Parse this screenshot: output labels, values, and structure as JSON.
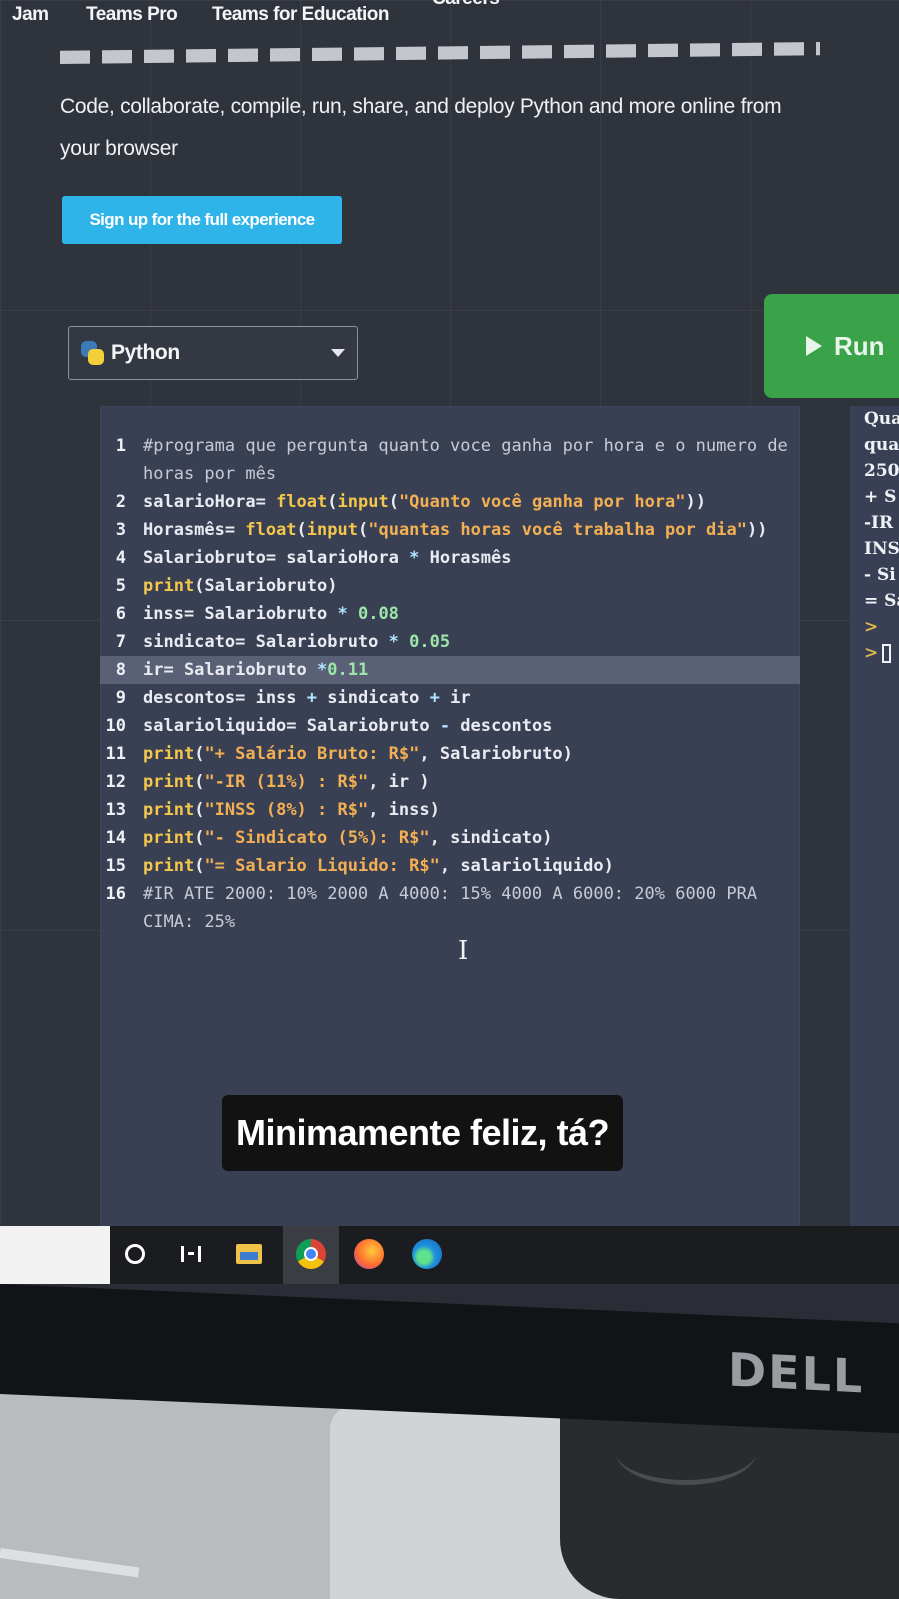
{
  "nav": {
    "items": [
      "Jam",
      "Teams Pro",
      "Teams for Education",
      "Careers"
    ]
  },
  "hero": {
    "tagline": "Code, collaborate, compile, run, share, and deploy Python and more online from your browser",
    "signup_label": "Sign up for the full experience"
  },
  "toolbar": {
    "language": "Python",
    "run_label": "Run"
  },
  "editor": {
    "lines": [
      {
        "n": "1",
        "html": "<span class=\"c\">#programa que pergunta quanto voce ganha por hora e o numero de horas por mês</span>"
      },
      {
        "n": "2",
        "html": "salarioHora= <span class=\"k\">float</span>(<span class=\"k\">input</span>(<span class=\"s\">\"Quanto você ganha por hora\"</span>))"
      },
      {
        "n": "3",
        "html": "Horasmês= <span class=\"k\">float</span>(<span class=\"k\">input</span>(<span class=\"s\">\"quantas horas você trabalha por dia\"</span>))"
      },
      {
        "n": "4",
        "html": "Salariobruto= salarioHora <span class=\"o\">*</span> Horasmês"
      },
      {
        "n": "5",
        "html": "<span class=\"k\">print</span>(Salariobruto)"
      },
      {
        "n": "6",
        "html": "inss= Salariobruto <span class=\"o\">*</span> <span class=\"n\">0.08</span>"
      },
      {
        "n": "7",
        "html": "sindicato= Salariobruto <span class=\"o\">*</span> <span class=\"n\">0.05</span>"
      },
      {
        "n": "8",
        "html": "ir= Salariobruto <span class=\"o\">*</span><span class=\"n\">0.11</span>"
      },
      {
        "n": "9",
        "html": "descontos= inss <span class=\"o\">+</span> sindicato <span class=\"o\">+</span> ir"
      },
      {
        "n": "10",
        "html": "salarioliquido= Salariobruto <span class=\"o\">-</span> descontos"
      },
      {
        "n": "11",
        "html": "<span class=\"k\">print</span>(<span class=\"s\">\"+ Salário Bruto: R$\"</span>, Salariobruto)"
      },
      {
        "n": "12",
        "html": "<span class=\"k\">print</span>(<span class=\"s\">\"-IR (11%) : R$\"</span>, ir )"
      },
      {
        "n": "13",
        "html": "<span class=\"k\">print</span>(<span class=\"s\">\"INSS (8%) : R$\"</span>, inss)"
      },
      {
        "n": "14",
        "html": "<span class=\"k\">print</span>(<span class=\"s\">\"- Sindicato (5%): R$\"</span>, sindicato)"
      },
      {
        "n": "15",
        "html": "<span class=\"k\">print</span>(<span class=\"s\">\"= Salario Liquido: R$\"</span>, salarioliquido)"
      },
      {
        "n": "16",
        "html": "<span class=\"c\">#IR ATE 2000: 10% 2000 A 4000: 15% 4000 A 6000: 20% 6000 PRA CIMA: 25%</span>"
      }
    ],
    "highlighted_line": "8"
  },
  "output": {
    "lines": [
      "Qua",
      "qua",
      "250",
      "+ S",
      "-IR",
      "INS",
      "- Si",
      "= Sa"
    ],
    "prompt_symbol": ">"
  },
  "caption": {
    "text": "Minimamente feliz, tá?"
  },
  "taskbar": {
    "icons": [
      "cortana-icon",
      "task-view-icon",
      "file-explorer-icon",
      "chrome-icon",
      "firefox-icon",
      "edge-icon"
    ]
  },
  "monitor": {
    "brand": "DELL"
  },
  "colors": {
    "run_button": "#3aa34a",
    "signup_button": "#2fb4ea",
    "editor_bg": "#3a4054"
  }
}
